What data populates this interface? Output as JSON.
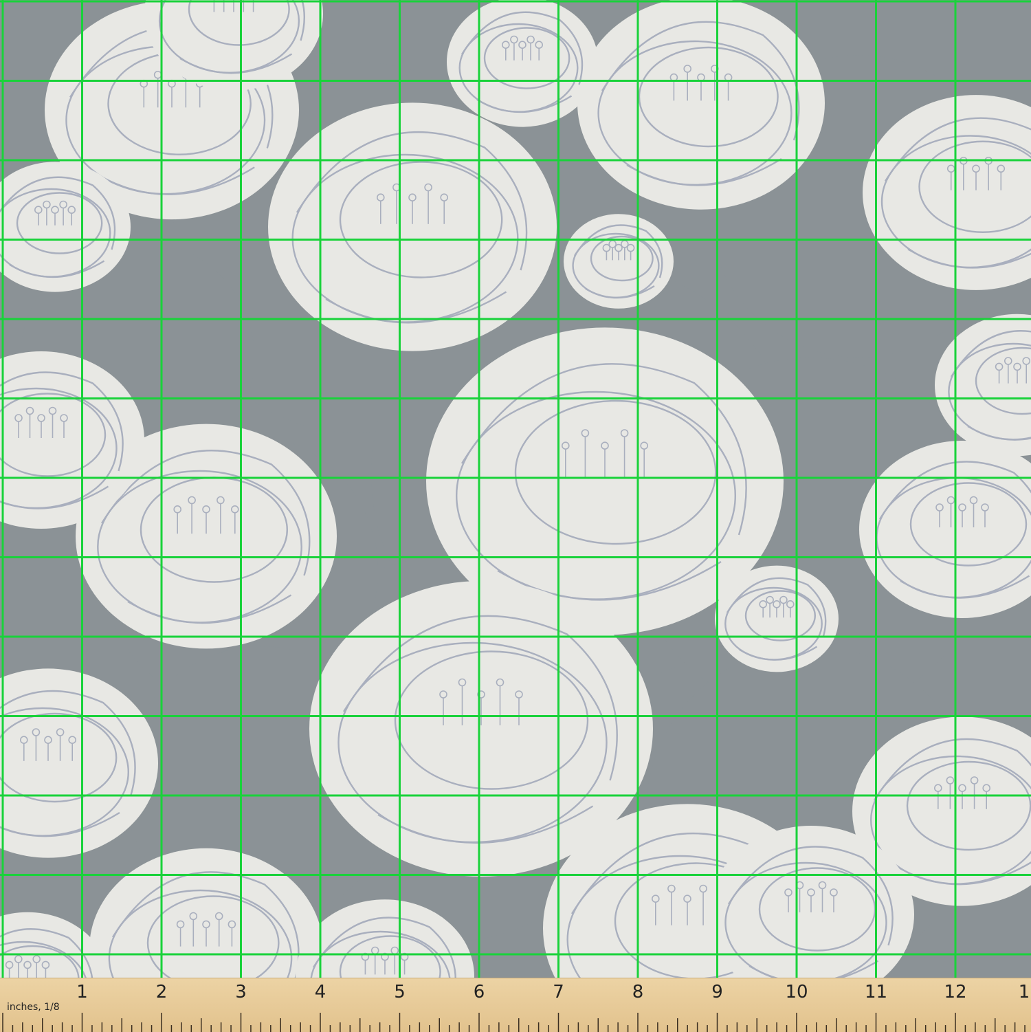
{
  "fabric": {
    "ground_color": "#e8e8e4",
    "shadow_color": "#8b9296",
    "outline_color": "#a9afbe"
  },
  "grid": {
    "line_color": "#19d23a",
    "columns": 13,
    "rows": 13
  },
  "ruler": {
    "unit_label": "inches, 1/8",
    "numbers": [
      "1",
      "2",
      "3",
      "4",
      "5",
      "6",
      "7",
      "8",
      "9",
      "10",
      "11",
      "12",
      "1"
    ],
    "color": "#e6c893"
  }
}
